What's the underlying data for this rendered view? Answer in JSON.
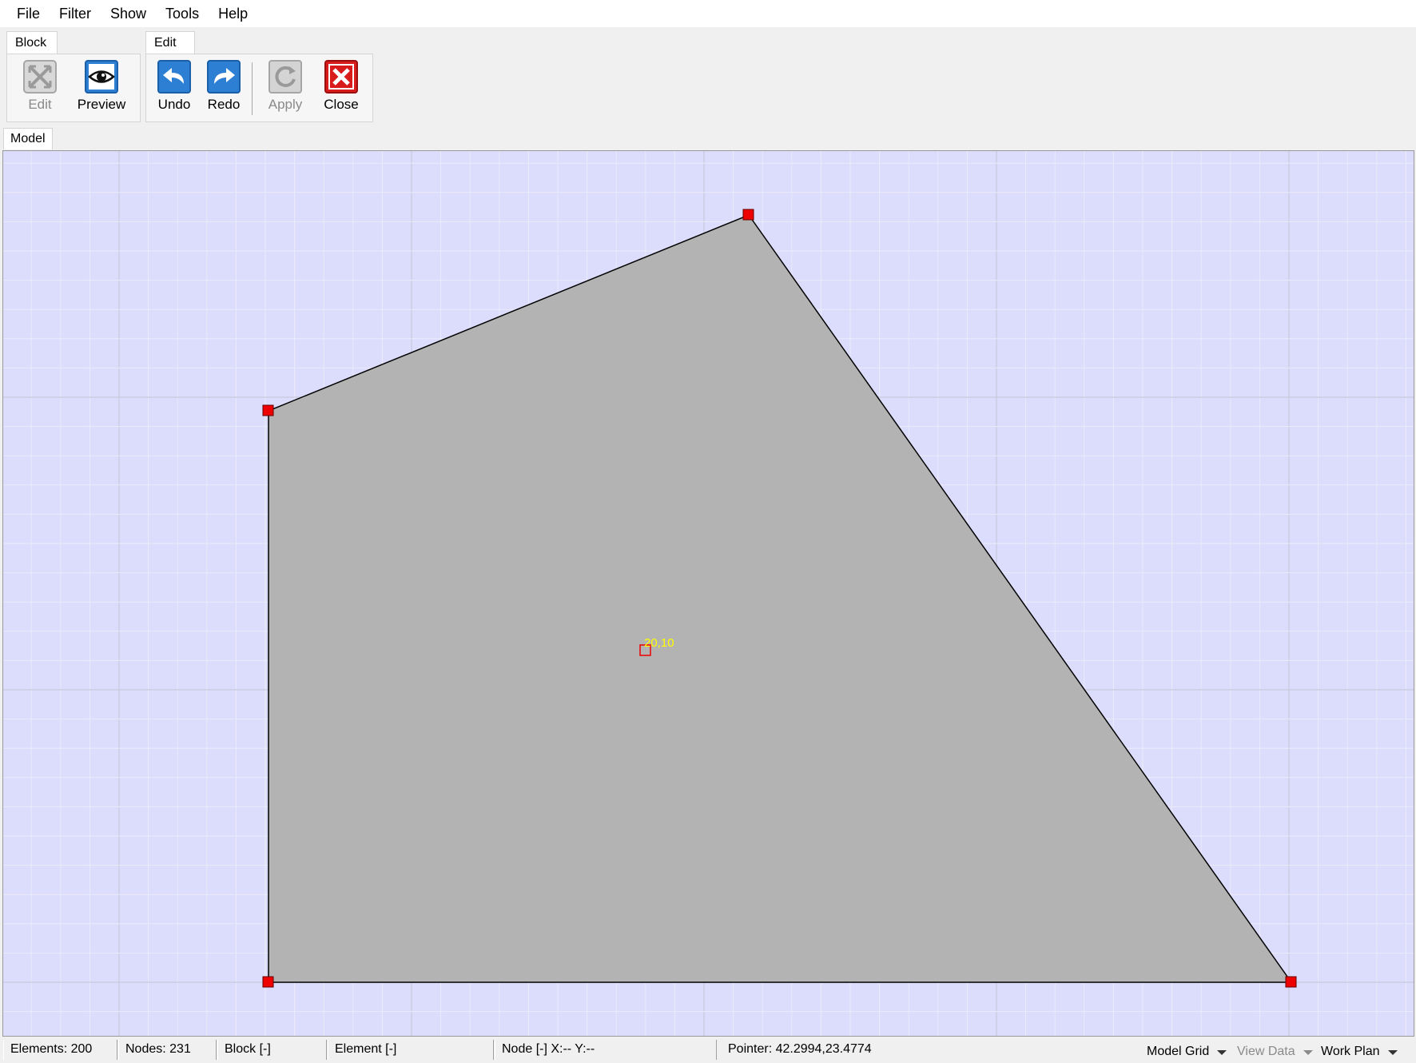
{
  "menu": {
    "items": [
      "File",
      "Filter",
      "Show",
      "Tools",
      "Help"
    ]
  },
  "ribbon": {
    "block_group": {
      "tab_label": "Block",
      "buttons": [
        {
          "label": "Edit",
          "icon": "block-edit-icon",
          "enabled": false
        },
        {
          "label": "Preview",
          "icon": "eye-preview-icon",
          "enabled": true
        }
      ]
    },
    "edit_group": {
      "tab_label": "Edit",
      "buttons": [
        {
          "label": "Undo",
          "icon": "undo-arrow-icon",
          "enabled": true
        },
        {
          "label": "Redo",
          "icon": "redo-arrow-icon",
          "enabled": true
        },
        {
          "label": "Apply",
          "icon": "apply-refresh-icon",
          "enabled": false
        },
        {
          "label": "Close",
          "icon": "close-x-icon",
          "enabled": true
        }
      ]
    }
  },
  "model_tab": {
    "label": "Model"
  },
  "canvas": {
    "background_color": "#dcdcfc",
    "block_fill_color": "#b3b3b3",
    "node_color": "#ee0000",
    "label_color": "#ffff00",
    "center_label": "20,10"
  },
  "statusbar": {
    "elements": "Elements: 200",
    "nodes": "Nodes: 231",
    "block": "Block [-]",
    "element": "Element [-]",
    "node": "Node [-]  X:-- Y:--",
    "pointer": "Pointer: 42.2994,23.4774",
    "model_grid": "Model Grid",
    "view_data": "View Data",
    "work_plan": "Work Plan"
  }
}
